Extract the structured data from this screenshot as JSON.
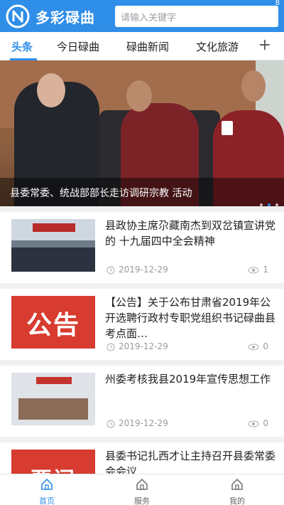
{
  "header": {
    "app_title": "多彩碌曲",
    "search_placeholder": "请输入关键字",
    "status_num": "8"
  },
  "tabs": [
    {
      "label": "头条"
    },
    {
      "label": "今日碌曲"
    },
    {
      "label": "碌曲新闻"
    },
    {
      "label": "文化旅游"
    }
  ],
  "hero": {
    "caption": "县委常委、统战部部长走访调研宗教 活动"
  },
  "articles": [
    {
      "title": "县政协主席尕藏南杰到双岔镇宣讲党的 十九届四中全会精神",
      "date": "2019-12-29",
      "views": "1"
    },
    {
      "title": "【公告】关于公布甘肃省2019年公开选聘行政村专职党组织书记碌曲县考点面…",
      "date": "2019-12-29",
      "views": "0",
      "thumb_text": "公告"
    },
    {
      "title": "州委考核我县2019年宣传思想工作",
      "date": "2019-12-29",
      "views": "0"
    },
    {
      "title": "县委书记扎西才让主持召开县委常委会会议",
      "date": "",
      "views": "",
      "thumb_text": "要闻"
    }
  ],
  "bottom_nav": [
    {
      "label": "首页",
      "icon": "home-icon"
    },
    {
      "label": "服务",
      "icon": "service-icon"
    },
    {
      "label": "我的",
      "icon": "user-icon"
    }
  ],
  "colors": {
    "accent": "#2f8ee8",
    "notice_red": "#d83b2f"
  }
}
